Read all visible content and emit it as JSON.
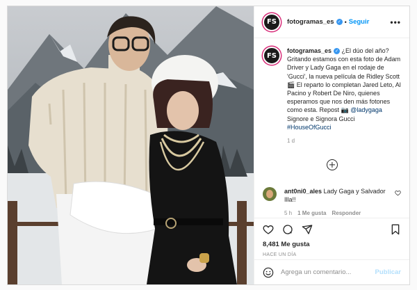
{
  "account": {
    "username": "fotogramas_es",
    "avatar_text": "FS",
    "follow_label": "Seguir",
    "more_label": "•••",
    "verified": true
  },
  "caption": {
    "username": "fotogramas_es",
    "text_before": "¿El dúo del año? Gritando estamos con esta foto de Adam Driver y Lady Gaga en el rodaje de 'Gucci', la nueva película de Ridley Scott 🎬 El reparto lo completan Jared Leto, Al Pacino y Robert De Niro, quienes esperamos que nos den más fotones como esta. Repost 📷",
    "mention": "@ladygaga",
    "text_after": " Signore e Signora Gucci",
    "hashtag": "#HouseOfGucci",
    "time": "1 d"
  },
  "comment": {
    "username": "ant0ni0_ales",
    "text": " Lady Gaga y Salvador Illa!!",
    "time": "5 h",
    "likes": "1 Me gusta",
    "reply_label": "Responder"
  },
  "post": {
    "likes": "8,481 Me gusta",
    "ago": "HACE UN DÍA",
    "comment_placeholder": "Agrega un comentario...",
    "publish_label": "Publicar"
  },
  "icons": {
    "like": "heart-icon",
    "comment": "comment-icon",
    "share": "share-icon",
    "save": "bookmark-icon",
    "emoji": "emoji-icon",
    "add": "plus-circle-icon"
  }
}
